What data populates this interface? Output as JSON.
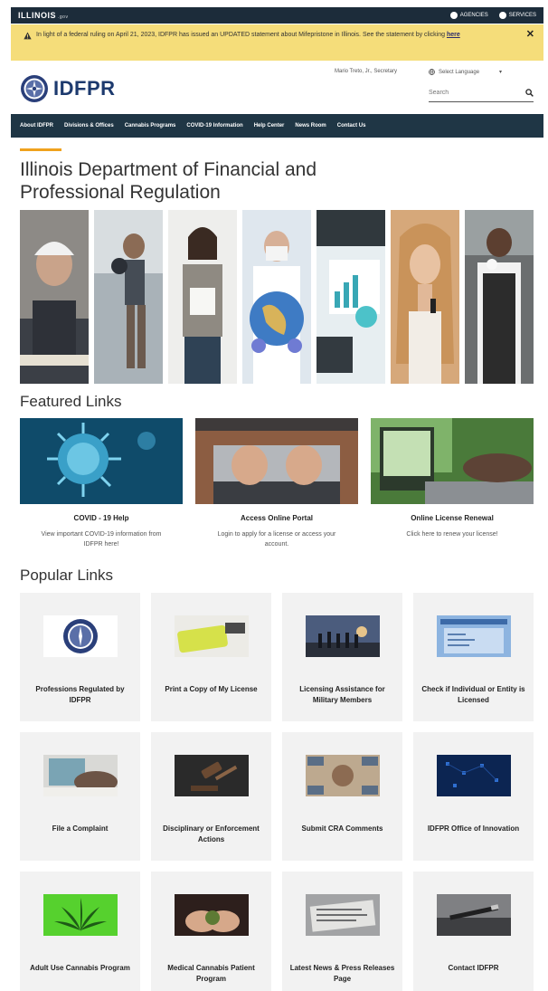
{
  "state_bar": {
    "logo": "ILLINOIS",
    "logo_suffix": ".gov",
    "agencies_label": "AGENCIES",
    "services_label": "SERVICES"
  },
  "alert": {
    "text": "In light of a federal ruling on April 21, 2023, IDFPR has issued an UPDATED statement about Mifepristone in Illinois. See the statement by clicking ",
    "link": "here",
    "close": "✕",
    "bg_color": "#f5dd7a"
  },
  "header": {
    "brand": "IDFPR",
    "secretary": "Mario Treto, Jr., Secretary",
    "language": "Select Language",
    "search_placeholder": "Search"
  },
  "nav": {
    "items": [
      "About IDFPR",
      "Divisions & Offices",
      "Cannabis Programs",
      "COVID-19 Information",
      "Help Center",
      "News Room",
      "Contact Us"
    ],
    "bg_color": "#1f3645"
  },
  "page": {
    "title": "Illinois Department of Financial and Professional Regulation",
    "accent_color": "#f0a21e"
  },
  "featured": {
    "heading": "Featured Links",
    "cards": [
      {
        "title": "COVID - 19 Help",
        "desc": "View important COVID-19 information from IDFPR here!"
      },
      {
        "title": "Access Online Portal",
        "desc": "Login to apply for a license or access your account."
      },
      {
        "title": "Online License Renewal",
        "desc": "Click here to renew your license!"
      }
    ]
  },
  "popular": {
    "heading": "Popular Links",
    "cards": [
      {
        "label": "Professions Regulated by IDFPR"
      },
      {
        "label": "Print a Copy of My License"
      },
      {
        "label": "Licensing Assistance for Military Members"
      },
      {
        "label": "Check if Individual or Entity is Licensed"
      },
      {
        "label": "File a Complaint"
      },
      {
        "label": "Disciplinary or Enforcement Actions"
      },
      {
        "label": "Submit CRA Comments"
      },
      {
        "label": "IDFPR Office of Innovation"
      },
      {
        "label": "Adult Use Cannabis Program"
      },
      {
        "label": "Medical Cannabis Patient Program"
      },
      {
        "label": "Latest News & Press Releases Page"
      },
      {
        "label": "Contact IDFPR"
      }
    ]
  }
}
